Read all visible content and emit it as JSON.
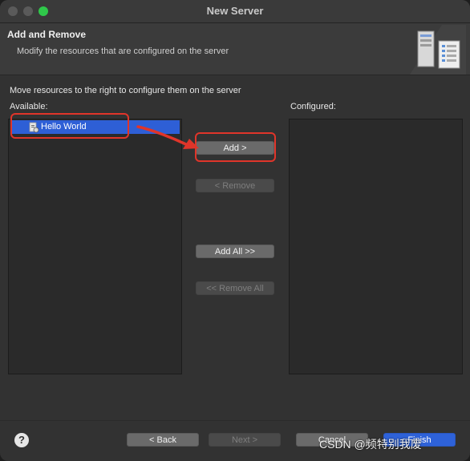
{
  "window": {
    "title": "New Server"
  },
  "header": {
    "title": "Add and Remove",
    "description": "Modify the resources that are configured on the server"
  },
  "instruction": "Move resources to the right to configure them on the server",
  "available": {
    "label": "Available:",
    "items": [
      {
        "label": "Hello World",
        "selected": true
      }
    ]
  },
  "configured": {
    "label": "Configured:",
    "items": []
  },
  "buttons": {
    "add": "Add >",
    "remove": "< Remove",
    "add_all": "Add All >>",
    "remove_all": "<< Remove All"
  },
  "footer": {
    "help": "?",
    "back": "< Back",
    "next": "Next >",
    "cancel": "Cancel",
    "finish": "Finish"
  },
  "watermark": "CSDN @频特别我废",
  "colors": {
    "selection": "#2e5fd6",
    "annotation": "#e0352a",
    "primary_button": "#2e62d9"
  }
}
